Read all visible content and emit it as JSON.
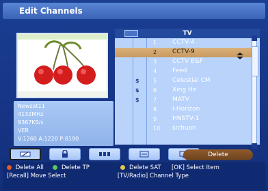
{
  "window": {
    "title": "Edit Channels"
  },
  "info": {
    "satellite": "Newsat11",
    "frequency": "4132MHz",
    "symbol_rate": "9367KS/s",
    "polarity": "VER",
    "pids": "V:1260 A:1220 P:8190"
  },
  "list": {
    "title": "TV",
    "selected_index": 1,
    "channels": [
      {
        "num": "1",
        "name": "CCTV-4",
        "scrambled": ""
      },
      {
        "num": "2",
        "name": "CCTV-9",
        "scrambled": ""
      },
      {
        "num": "3",
        "name": "CCTV E&F",
        "scrambled": ""
      },
      {
        "num": "4",
        "name": "Feed",
        "scrambled": ""
      },
      {
        "num": "5",
        "name": "Celestial CM",
        "scrambled": "$"
      },
      {
        "num": "6",
        "name": "Xing He",
        "scrambled": "$"
      },
      {
        "num": "7",
        "name": "MATV",
        "scrambled": "$"
      },
      {
        "num": "8",
        "name": "I-Horizon",
        "scrambled": ""
      },
      {
        "num": "9",
        "name": "HNSTV-1",
        "scrambled": ""
      },
      {
        "num": "10",
        "name": "sichuan",
        "scrambled": ""
      }
    ]
  },
  "toolbar": {
    "buttons": [
      {
        "name": "edit-tool-button",
        "icon": "eraser-icon"
      },
      {
        "name": "lock-tool-button",
        "icon": "lock-icon"
      },
      {
        "name": "move-tool-button",
        "icon": "move-icon"
      },
      {
        "name": "rename-tool-button",
        "icon": "rename-icon"
      },
      {
        "name": "skip-tool-button",
        "icon": "monitor-icon"
      }
    ],
    "delete_label": "Delete"
  },
  "legend": {
    "line1": {
      "delete_all": "Delete All",
      "delete_tp": "Delete TP",
      "delete_sat": "Delete SAT",
      "select_item": "[OK] Select Item"
    },
    "line2": {
      "move_select": "[Recall] Move Select",
      "channel_type": "[TV/Radio] Channel Type"
    }
  },
  "colors": {
    "highlight": "#d9b17b",
    "delete_button": "#8f5b2c",
    "red_key": "#e05a2a",
    "green_key": "#5ac85a",
    "yellow_key": "#e2c84a"
  }
}
